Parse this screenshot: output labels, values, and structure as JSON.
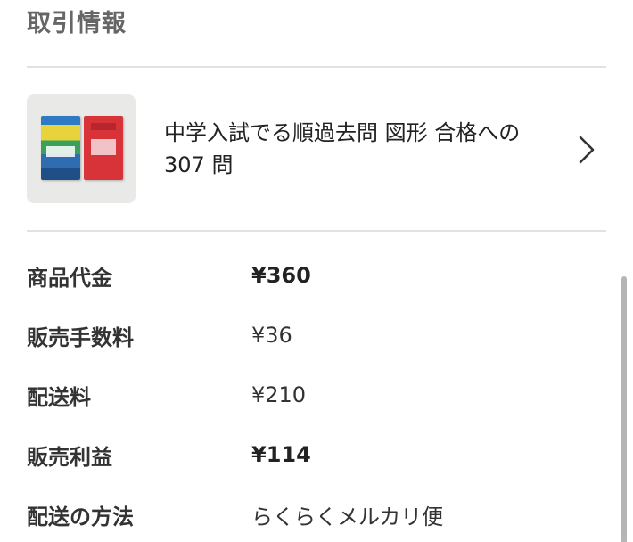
{
  "section": {
    "title": "取引情報"
  },
  "item": {
    "title": "中学入試でる順過去問 図形 合格への 307 問",
    "chevron_icon": "chevron-right-icon"
  },
  "details": [
    {
      "label": "商品代金",
      "value": "¥360",
      "bold": true
    },
    {
      "label": "販売手数料",
      "value": "¥36",
      "bold": false
    },
    {
      "label": "配送料",
      "value": "¥210",
      "bold": false
    },
    {
      "label": "販売利益",
      "value": "¥114",
      "bold": true
    },
    {
      "label": "配送の方法",
      "value": "らくらくメルカリ便",
      "bold": false
    }
  ]
}
